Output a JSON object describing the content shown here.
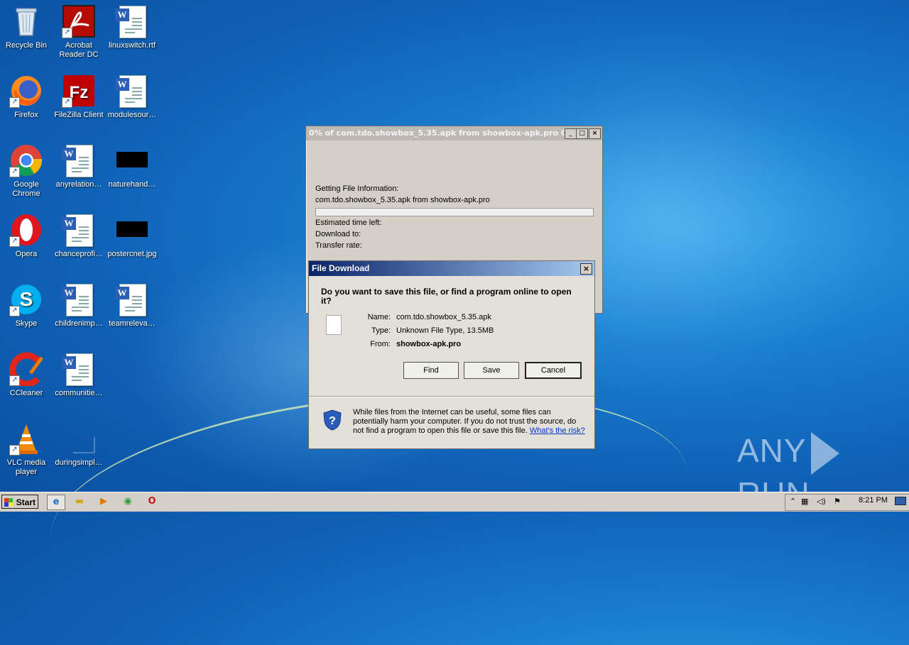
{
  "desktop": {
    "icons": [
      {
        "label": "Recycle Bin",
        "glyph": "🗑"
      },
      {
        "label": "Acrobat Reader DC",
        "glyph": "A"
      },
      {
        "label": "linuxswitch.rtf"
      },
      {
        "label": "Firefox",
        "glyph": "🦊"
      },
      {
        "label": "FileZilla Client",
        "glyph": "Fz"
      },
      {
        "label": "modulesour…"
      },
      {
        "label": "Google Chrome",
        "glyph": "◉"
      },
      {
        "label": "anyrelation…"
      },
      {
        "label": "naturehand…"
      },
      {
        "label": "Opera",
        "glyph": "O"
      },
      {
        "label": "chanceprofi…"
      },
      {
        "label": "postercnet.jpg"
      },
      {
        "label": "Skype",
        "glyph": "S"
      },
      {
        "label": "childrenimp…"
      },
      {
        "label": "teamreleva…"
      },
      {
        "label": "CCleaner",
        "glyph": "C"
      },
      {
        "label": "communitie…"
      },
      {
        "label": "VLC media player",
        "glyph": "▲"
      },
      {
        "label": "duringsimpl…"
      }
    ]
  },
  "progress_window": {
    "title": "0% of com.tdo.showbox_5.35.apk from showbox-apk.pro Co...",
    "status_label": "Getting File Information:",
    "file_line": "com.tdo.showbox_5.35.apk from showbox-apk.pro",
    "progress_fraction": 0,
    "estimated_label": "Estimated time left:",
    "download_to_label": "Download to:",
    "transfer_rate_label": "Transfer rate:"
  },
  "dialog": {
    "title": "File Download",
    "question": "Do you want to save this file, or find a program online to open it?",
    "name_label": "Name:",
    "name_value": "com.tdo.showbox_5.35.apk",
    "type_label": "Type:",
    "type_value": "Unknown File Type, 13.5MB",
    "from_label": "From:",
    "from_value": "showbox-apk.pro",
    "find_label": "Find",
    "save_label": "Save",
    "cancel_label": "Cancel",
    "warning_text": "While files from the Internet can be useful, some files can potentially harm your computer. If you do not trust the source, do not find a program to open this file or save this file. ",
    "risk_link": "What's the risk?"
  },
  "taskbar": {
    "start_label": "Start",
    "clock": "8:21 PM"
  },
  "watermark": {
    "left": "ANY",
    "right": "RUN"
  }
}
